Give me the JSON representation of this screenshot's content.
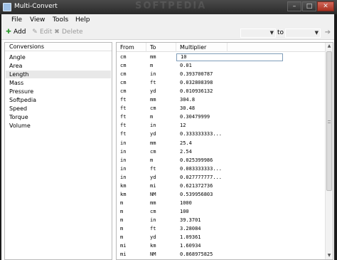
{
  "window": {
    "title": "Multi-Convert",
    "watermark": "SOFTPEDIA",
    "controls": {
      "minimize": "–",
      "maximize": "□",
      "close": "✕"
    }
  },
  "menubar": {
    "items": [
      "File",
      "View",
      "Tools",
      "Help"
    ]
  },
  "toolbar": {
    "add_label": "Add",
    "edit_label": "Edit",
    "delete_label": "Delete",
    "from_unit_value": "",
    "to_label": "to",
    "to_unit_value": "",
    "icons": {
      "add": "plus-icon",
      "edit": "pencil-icon",
      "delete": "x-icon",
      "go": "arrow-right-icon"
    }
  },
  "conversions": {
    "header": "Conversions",
    "selected": "Length",
    "items": [
      "Angle",
      "Area",
      "Length",
      "Mass",
      "Pressure",
      "Softpedia",
      "Speed",
      "Torque",
      "Volume"
    ]
  },
  "grid": {
    "columns": [
      "From",
      "To",
      "Multiplier"
    ],
    "rows": [
      [
        "cm",
        "mm",
        "10"
      ],
      [
        "cm",
        "m",
        "0.01"
      ],
      [
        "cm",
        "in",
        "0.393700787"
      ],
      [
        "cm",
        "ft",
        "0.032808398"
      ],
      [
        "cm",
        "yd",
        "0.010936132"
      ],
      [
        "ft",
        "mm",
        "304.8"
      ],
      [
        "ft",
        "cm",
        "30.48"
      ],
      [
        "ft",
        "m",
        "0.30479999"
      ],
      [
        "ft",
        "in",
        "12"
      ],
      [
        "ft",
        "yd",
        "0.333333333..."
      ],
      [
        "in",
        "mm",
        "25.4"
      ],
      [
        "in",
        "cm",
        "2.54"
      ],
      [
        "in",
        "m",
        "0.025399986"
      ],
      [
        "in",
        "ft",
        "0.083333333..."
      ],
      [
        "in",
        "yd",
        "0.027777777..."
      ],
      [
        "km",
        "mi",
        "0.621372736"
      ],
      [
        "km",
        "NM",
        "0.539956803"
      ],
      [
        "m",
        "mm",
        "1000"
      ],
      [
        "m",
        "cm",
        "100"
      ],
      [
        "m",
        "in",
        "39.3701"
      ],
      [
        "m",
        "ft",
        "3.28084"
      ],
      [
        "m",
        "yd",
        "1.09361"
      ],
      [
        "mi",
        "km",
        "1.60934"
      ],
      [
        "mi",
        "NM",
        "0.868975825"
      ]
    ]
  }
}
